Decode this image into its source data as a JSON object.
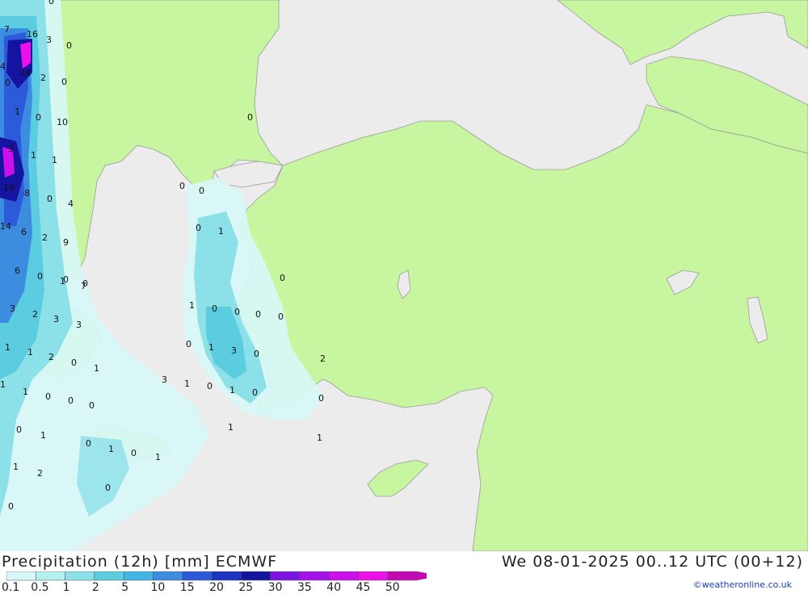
{
  "header": {
    "title": "Precipitation (12h) [mm] ECMWF",
    "datetime": "We 08-01-2025 00..12 UTC (00+12)",
    "credit": "©weatheronline.co.uk"
  },
  "legend": {
    "labels": [
      "0.1",
      "0.5",
      "1",
      "2",
      "5",
      "10",
      "15",
      "20",
      "25",
      "30",
      "35",
      "40",
      "45",
      "50"
    ],
    "colors": [
      "#d8f8f8",
      "#b4f0f0",
      "#8ce0e8",
      "#5ccce0",
      "#44b4e4",
      "#3c8ce0",
      "#2c5ad8",
      "#1c34c0",
      "#1414a0",
      "#7c14e4",
      "#a410e8",
      "#cc10ec",
      "#ee10e8",
      "#c408b4"
    ]
  },
  "map": {
    "land_color": "#c8f5a0",
    "sea_color": "#ececec",
    "border_color": "#9a9a9a",
    "values": [
      "7",
      "16",
      "3",
      "0",
      "4",
      "24",
      "2",
      "0",
      "0",
      "1",
      "0",
      "10",
      "3",
      "1",
      "1",
      "16",
      "8",
      "0",
      "4",
      "14",
      "6",
      "2",
      "9",
      "6",
      "0",
      "1",
      "7",
      "3",
      "2",
      "3",
      "3",
      "1",
      "1",
      "2",
      "0",
      "1",
      "1",
      "1",
      "0",
      "0",
      "0",
      "0",
      "1",
      "0",
      "1",
      "0",
      "1",
      "1",
      "2",
      "0",
      "0",
      "0",
      "0",
      "0",
      "1",
      "0",
      "1",
      "0",
      "0",
      "0",
      "0",
      "0",
      "1",
      "3",
      "0",
      "3",
      "1",
      "0",
      "1",
      "0",
      "2",
      "1",
      "0",
      "1",
      "0",
      "0",
      "0",
      "0"
    ]
  }
}
